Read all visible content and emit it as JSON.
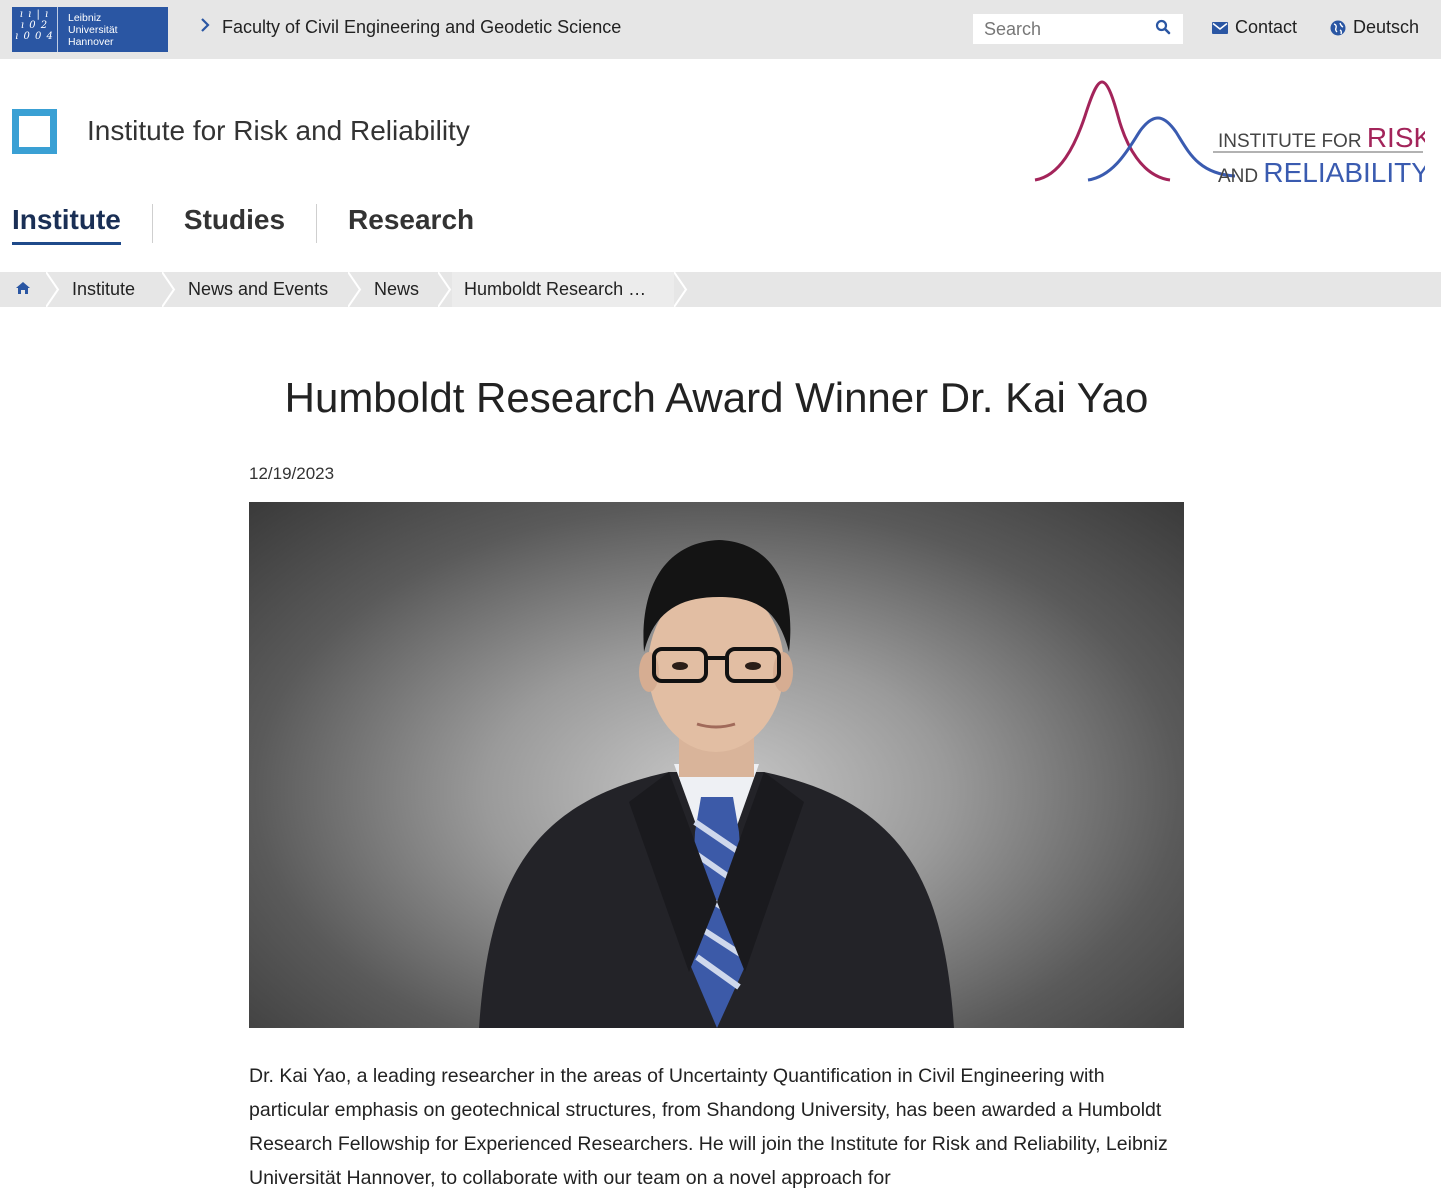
{
  "topbar": {
    "university_logo_lines": [
      "Leibniz",
      "Universität",
      "Hannover"
    ],
    "university_logo_glyphs": [
      "ı ı | ı",
      "ı 0 2",
      "ı 0 0 4"
    ],
    "faculty_link": "Faculty of Civil Engineering and Geodetic Science",
    "search_placeholder": "Search",
    "contact_label": "Contact",
    "language_label": "Deutsch"
  },
  "header": {
    "institute_title": "Institute for Risk and Reliability",
    "logo_text_line1_a": "INSTITUTE FOR ",
    "logo_text_line1_b": "RISK",
    "logo_text_line2_a": "AND ",
    "logo_text_line2_b": "RELIABILITY"
  },
  "nav": {
    "items": [
      {
        "label": "Institute",
        "active": true
      },
      {
        "label": "Studies",
        "active": false
      },
      {
        "label": "Research",
        "active": false
      }
    ]
  },
  "breadcrumb": {
    "items": [
      "Institute",
      "News and Events",
      "News",
      "Humboldt Research …"
    ]
  },
  "article": {
    "title": "Humboldt Research Award Winner Dr. Kai Yao",
    "date": "12/19/2023",
    "body": "Dr. Kai Yao, a leading researcher in the areas of Uncertainty Quantification in Civil Engineering with particular emphasis on geotechnical structures, from Shandong University, has been awarded a Humboldt Research Fellowship for Experienced Researchers. He will join the Institute for Risk and Reliability, Leibniz Universität Hannover, to collaborate with our team on a novel approach for"
  },
  "colors": {
    "luh_blue": "#2a56a3",
    "accent_blue": "#3aa0d4",
    "logo_magenta": "#a3245a",
    "logo_blue": "#3a5bb0"
  }
}
